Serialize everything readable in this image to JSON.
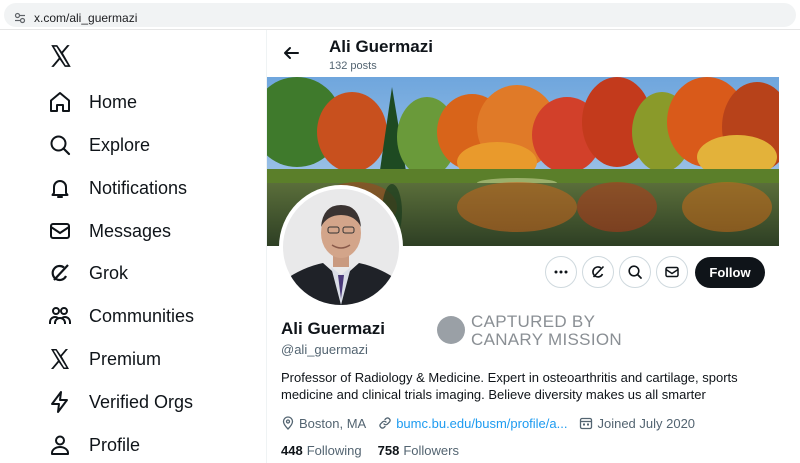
{
  "browser": {
    "url": "x.com/ali_guermazi"
  },
  "sidebar": {
    "items": [
      {
        "label": "Home",
        "icon": "home-icon"
      },
      {
        "label": "Explore",
        "icon": "search-icon"
      },
      {
        "label": "Notifications",
        "icon": "bell-icon"
      },
      {
        "label": "Messages",
        "icon": "envelope-icon"
      },
      {
        "label": "Grok",
        "icon": "grok-icon"
      },
      {
        "label": "Communities",
        "icon": "people-icon"
      },
      {
        "label": "Premium",
        "icon": "x-logo-icon"
      },
      {
        "label": "Verified Orgs",
        "icon": "lightning-icon"
      },
      {
        "label": "Profile",
        "icon": "person-icon"
      }
    ]
  },
  "header": {
    "name": "Ali Guermazi",
    "posts": "132 posts"
  },
  "profile": {
    "name": "Ali Guermazi",
    "handle": "@ali_guermazi",
    "bio": "Professor of Radiology & Medicine. Expert in osteoarthritis and cartilage, sports medicine and clinical trials imaging. Believe diversity makes us all smarter",
    "location": "Boston, MA",
    "website": "bumc.bu.edu/busm/profile/a...",
    "joined": "Joined July 2020",
    "following_count": "448",
    "following_label": "Following",
    "followers_count": "758",
    "followers_label": "Followers",
    "follow_label": "Follow"
  },
  "watermark": {
    "line1": "CAPTURED BY",
    "line2": "CANARY MISSION"
  },
  "colors": {
    "accent": "#1d9bf0",
    "text": "#0f1419",
    "muted": "#536471",
    "button": "#0f1419"
  }
}
